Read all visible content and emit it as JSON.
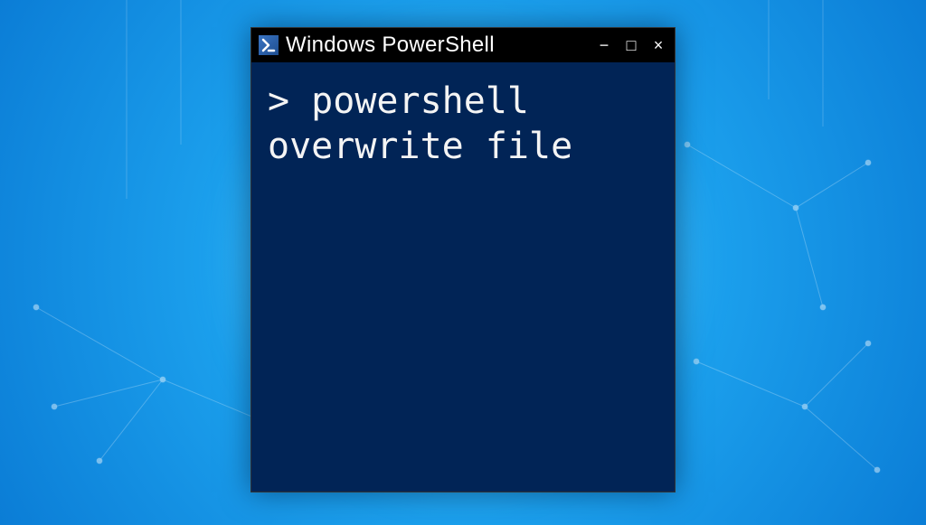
{
  "window": {
    "title": "Windows PowerShell",
    "icon": "powershell-icon",
    "controls": {
      "minimize": "−",
      "maximize": "□",
      "close": "×"
    }
  },
  "terminal": {
    "prompt": "> ",
    "command": "powershell overwrite file"
  },
  "colors": {
    "titlebar_bg": "#000000",
    "terminal_bg": "#012456",
    "text": "#f4f4f4"
  }
}
